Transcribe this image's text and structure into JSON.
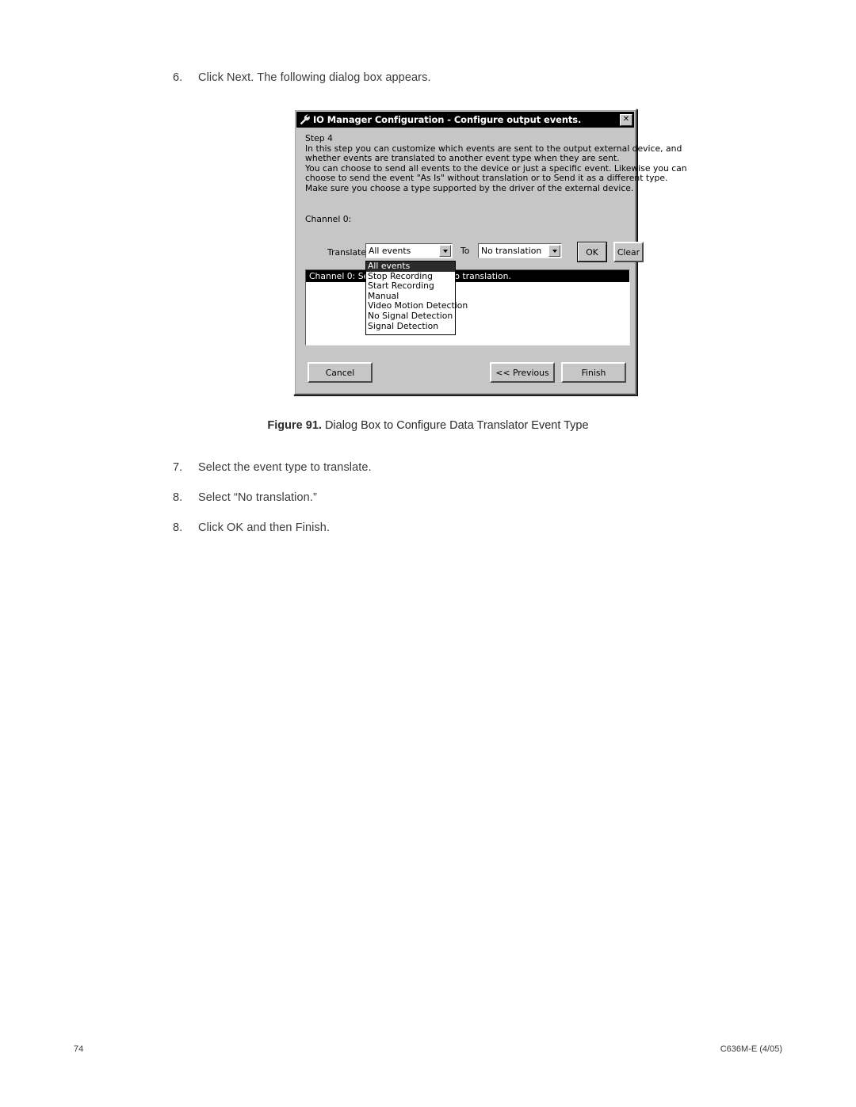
{
  "page": {
    "steps": [
      {
        "num": "6.",
        "text": "Click Next. The following dialog box appears."
      },
      {
        "num": "7.",
        "text": "Select the event type to translate."
      },
      {
        "num": "8.",
        "text": "Select “No translation.”"
      },
      {
        "num": "8.",
        "text": "Click OK and then Finish."
      }
    ],
    "figure_caption": {
      "label": "Figure 91.",
      "text": "Dialog Box to Configure Data Translator Event Type"
    },
    "footer": {
      "page_number": "74",
      "doc_code": "C636M-E (4/05)"
    }
  },
  "dialog": {
    "title": "IO Manager Configuration - Configure output events.",
    "title_icon": "wrench-icon",
    "close_label": "✕",
    "step_heading": "Step 4",
    "body_lines": [
      "In this step you can customize which events are sent to the output external device, and",
      "whether events are translated to another event type when they are sent.",
      "You can choose to send all events to the device or just a specific event. Likewise you can",
      "choose to send the event \"As Is\" without translation or to Send it as a different type.",
      "Make sure you choose a type supported by the driver of the external device."
    ],
    "channel_label": "Channel 0:",
    "translate_label": "Translate",
    "to_label": "To",
    "translate_combo": {
      "value": "All events",
      "options": [
        "All events",
        "Stop Recording",
        "Start Recording",
        "Manual",
        "Video Motion Detection",
        "No Signal Detection",
        "Signal Detection"
      ],
      "selected_index": 0,
      "expanded": true
    },
    "to_combo": {
      "value": "No translation"
    },
    "ok_label": "OK",
    "clear_label": "Clear",
    "summary_row": "Channel 0:  Send All events with No translation.",
    "cancel_label": "Cancel",
    "previous_label": "<< Previous",
    "finish_label": "Finish",
    "colors": {
      "face": "#c6c6c6",
      "titlebar": "#000000",
      "highlight": "#ffffff",
      "shadow": "#4a4a4a",
      "selection": "#2b2b2b"
    }
  }
}
